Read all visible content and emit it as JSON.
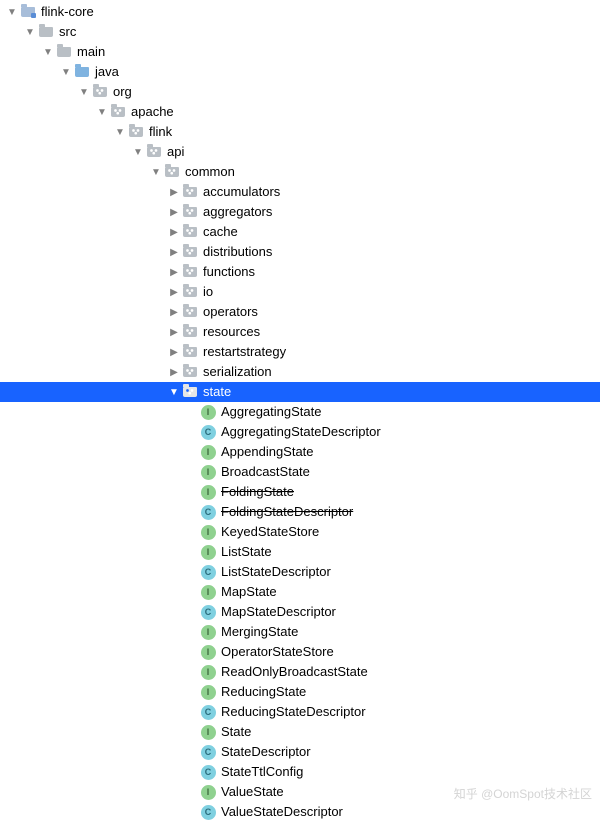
{
  "watermark": "知乎 @OomSpot技术社区",
  "tree": [
    {
      "depth": 0,
      "arrow": "down",
      "icon": "module",
      "label": "flink-core"
    },
    {
      "depth": 1,
      "arrow": "down",
      "icon": "folder",
      "label": "src"
    },
    {
      "depth": 2,
      "arrow": "down",
      "icon": "folder",
      "label": "main"
    },
    {
      "depth": 3,
      "arrow": "down",
      "icon": "src",
      "label": "java"
    },
    {
      "depth": 4,
      "arrow": "down",
      "icon": "pkg",
      "label": "org"
    },
    {
      "depth": 5,
      "arrow": "down",
      "icon": "pkg",
      "label": "apache"
    },
    {
      "depth": 6,
      "arrow": "down",
      "icon": "pkg",
      "label": "flink"
    },
    {
      "depth": 7,
      "arrow": "down",
      "icon": "pkg",
      "label": "api"
    },
    {
      "depth": 8,
      "arrow": "down",
      "icon": "pkg",
      "label": "common"
    },
    {
      "depth": 9,
      "arrow": "right",
      "icon": "pkg",
      "label": "accumulators"
    },
    {
      "depth": 9,
      "arrow": "right",
      "icon": "pkg",
      "label": "aggregators"
    },
    {
      "depth": 9,
      "arrow": "right",
      "icon": "pkg",
      "label": "cache"
    },
    {
      "depth": 9,
      "arrow": "right",
      "icon": "pkg",
      "label": "distributions"
    },
    {
      "depth": 9,
      "arrow": "right",
      "icon": "pkg",
      "label": "functions"
    },
    {
      "depth": 9,
      "arrow": "right",
      "icon": "pkg",
      "label": "io"
    },
    {
      "depth": 9,
      "arrow": "right",
      "icon": "pkg",
      "label": "operators"
    },
    {
      "depth": 9,
      "arrow": "right",
      "icon": "pkg",
      "label": "resources"
    },
    {
      "depth": 9,
      "arrow": "right",
      "icon": "pkg",
      "label": "restartstrategy"
    },
    {
      "depth": 9,
      "arrow": "right",
      "icon": "pkg",
      "label": "serialization"
    },
    {
      "depth": 9,
      "arrow": "down",
      "icon": "pkg",
      "label": "state",
      "selected": true
    },
    {
      "depth": 10,
      "arrow": "none",
      "icon": "interface",
      "label": "AggregatingState"
    },
    {
      "depth": 10,
      "arrow": "none",
      "icon": "class",
      "label": "AggregatingStateDescriptor"
    },
    {
      "depth": 10,
      "arrow": "none",
      "icon": "interface",
      "label": "AppendingState"
    },
    {
      "depth": 10,
      "arrow": "none",
      "icon": "interface",
      "label": "BroadcastState"
    },
    {
      "depth": 10,
      "arrow": "none",
      "icon": "interface",
      "label": "FoldingState",
      "strike": true
    },
    {
      "depth": 10,
      "arrow": "none",
      "icon": "class",
      "label": "FoldingStateDescriptor",
      "strike": true
    },
    {
      "depth": 10,
      "arrow": "none",
      "icon": "interface",
      "label": "KeyedStateStore"
    },
    {
      "depth": 10,
      "arrow": "none",
      "icon": "interface",
      "label": "ListState"
    },
    {
      "depth": 10,
      "arrow": "none",
      "icon": "class",
      "label": "ListStateDescriptor"
    },
    {
      "depth": 10,
      "arrow": "none",
      "icon": "interface",
      "label": "MapState"
    },
    {
      "depth": 10,
      "arrow": "none",
      "icon": "class",
      "label": "MapStateDescriptor"
    },
    {
      "depth": 10,
      "arrow": "none",
      "icon": "interface",
      "label": "MergingState"
    },
    {
      "depth": 10,
      "arrow": "none",
      "icon": "interface",
      "label": "OperatorStateStore"
    },
    {
      "depth": 10,
      "arrow": "none",
      "icon": "interface",
      "label": "ReadOnlyBroadcastState"
    },
    {
      "depth": 10,
      "arrow": "none",
      "icon": "interface",
      "label": "ReducingState"
    },
    {
      "depth": 10,
      "arrow": "none",
      "icon": "class",
      "label": "ReducingStateDescriptor"
    },
    {
      "depth": 10,
      "arrow": "none",
      "icon": "interface",
      "label": "State"
    },
    {
      "depth": 10,
      "arrow": "none",
      "icon": "class",
      "label": "StateDescriptor"
    },
    {
      "depth": 10,
      "arrow": "none",
      "icon": "class",
      "label": "StateTtlConfig"
    },
    {
      "depth": 10,
      "arrow": "none",
      "icon": "interface",
      "label": "ValueState"
    },
    {
      "depth": 10,
      "arrow": "none",
      "icon": "class",
      "label": "ValueStateDescriptor"
    }
  ]
}
